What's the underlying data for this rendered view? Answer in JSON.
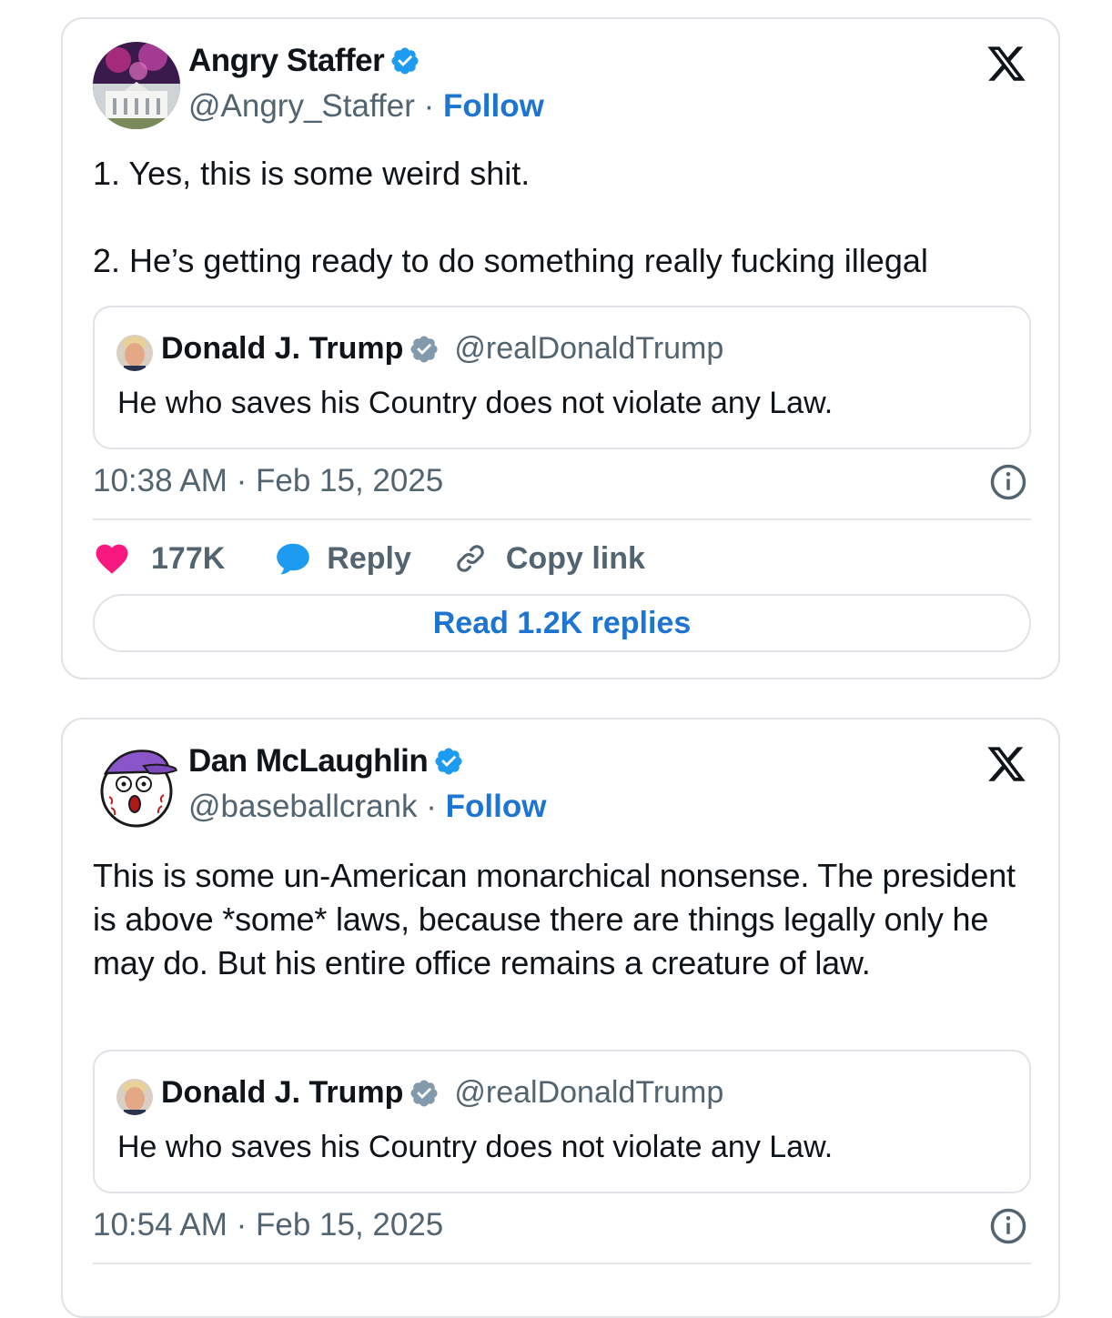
{
  "tweets": [
    {
      "author_name": "Angry Staffer",
      "handle": "@Angry_Staffer",
      "separator": "·",
      "follow_label": "Follow",
      "text_lines": [
        "1. Yes, this is some weird shit.",
        "2. He’s getting ready to do something really fucking illegal"
      ],
      "quote": {
        "author_name": "Donald J. Trump",
        "handle": "@realDonaldTrump",
        "text": "He who saves his Country does not violate any Law."
      },
      "timestamp": "10:38 AM · Feb 15, 2025",
      "likes": "177K",
      "reply_label": "Reply",
      "copy_link_label": "Copy link",
      "read_replies_label": "Read 1.2K replies"
    },
    {
      "author_name": "Dan McLaughlin",
      "handle": "@baseballcrank",
      "separator": "·",
      "follow_label": "Follow",
      "text": "This is some un-American monarchical nonsense. The president is above *some* laws, because there are things legally only he may do. But his entire office remains a creature of law.",
      "quote": {
        "author_name": "Donald J. Trump",
        "handle": "@realDonaldTrump",
        "text": "He who saves his Country does not violate any Law."
      },
      "timestamp": "10:54 AM · Feb 15, 2025"
    }
  ],
  "colors": {
    "link": "#1d74d1",
    "verified": "#1d9bf0",
    "gray_badge": "#829aab",
    "like": "#f91880",
    "muted": "#536471"
  },
  "icons": [
    "verified-badge-icon",
    "x-logo-icon",
    "info-icon",
    "heart-icon",
    "reply-bubble-icon",
    "link-icon"
  ]
}
